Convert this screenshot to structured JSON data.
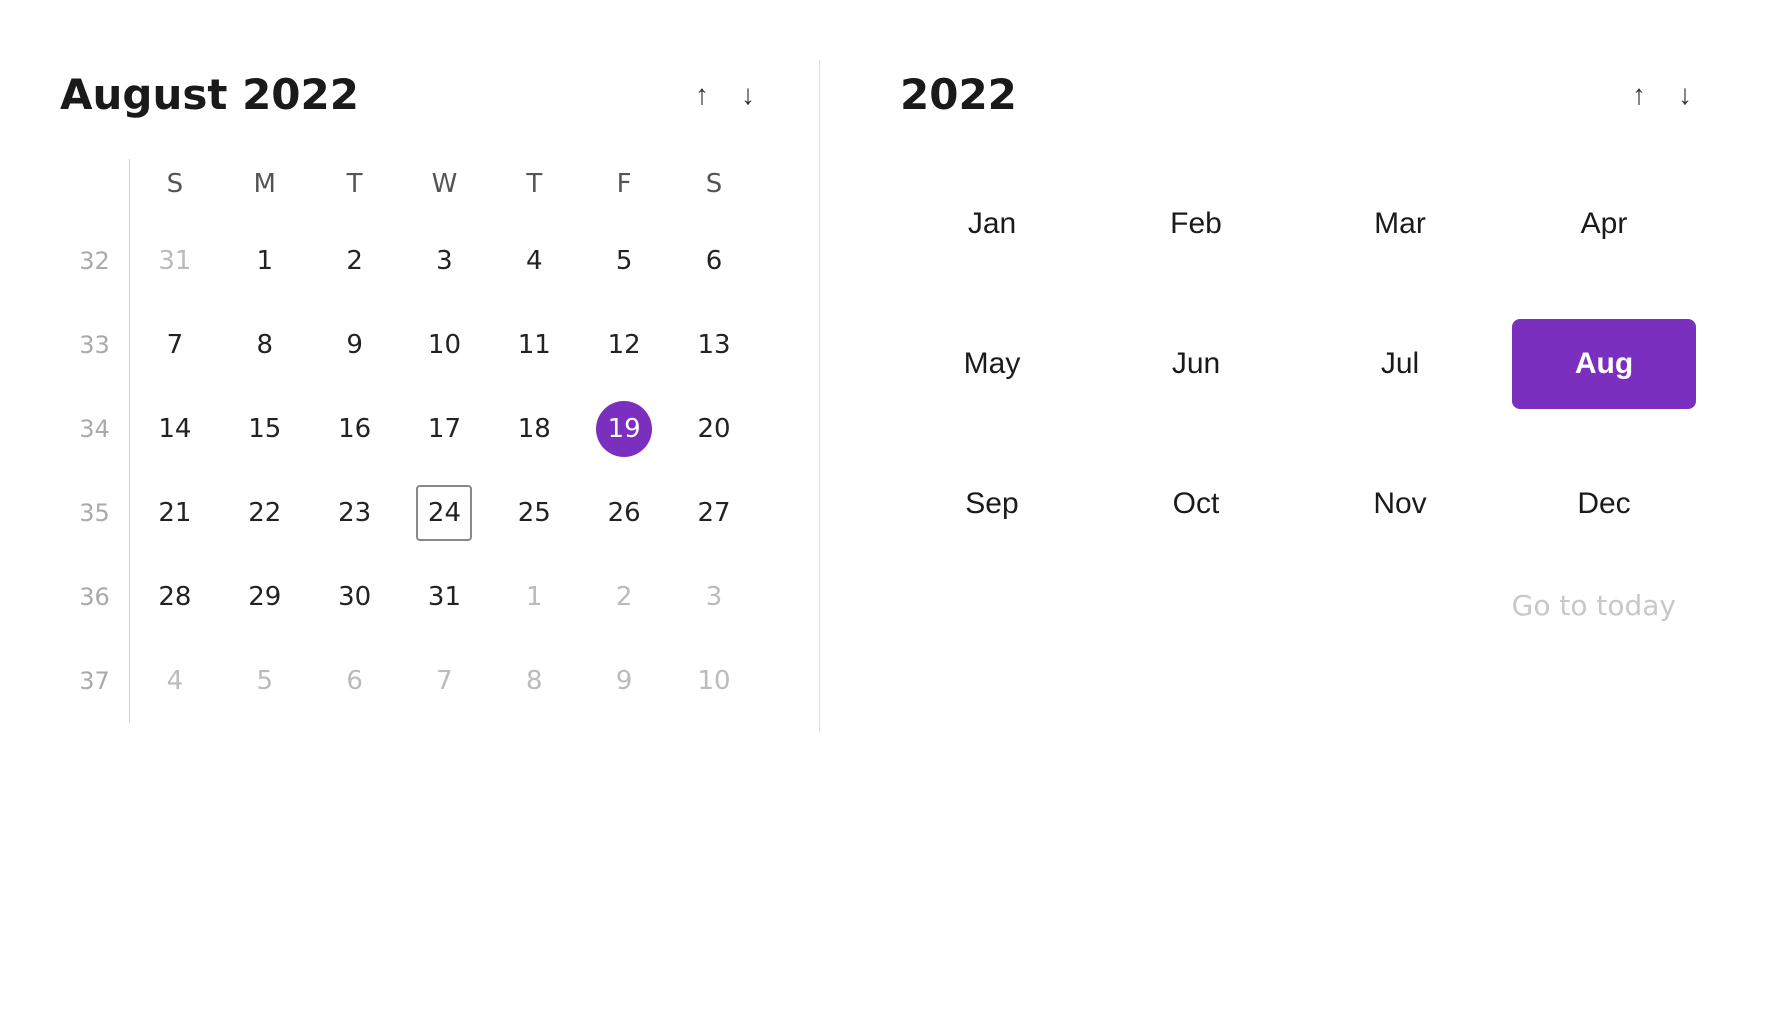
{
  "left": {
    "title": "August 2022",
    "nav_up_label": "↑",
    "nav_down_label": "↓",
    "day_headers": [
      "S",
      "M",
      "T",
      "W",
      "T",
      "F",
      "S"
    ],
    "weeks": [
      {
        "week_num": "32",
        "days": [
          {
            "num": "31",
            "other": true
          },
          {
            "num": "1"
          },
          {
            "num": "2"
          },
          {
            "num": "3"
          },
          {
            "num": "4"
          },
          {
            "num": "5"
          },
          {
            "num": "6"
          }
        ]
      },
      {
        "week_num": "33",
        "days": [
          {
            "num": "7"
          },
          {
            "num": "8"
          },
          {
            "num": "9"
          },
          {
            "num": "10"
          },
          {
            "num": "11"
          },
          {
            "num": "12"
          },
          {
            "num": "13"
          }
        ]
      },
      {
        "week_num": "34",
        "days": [
          {
            "num": "14"
          },
          {
            "num": "15"
          },
          {
            "num": "16"
          },
          {
            "num": "17"
          },
          {
            "num": "18"
          },
          {
            "num": "19",
            "selected": true
          },
          {
            "num": "20"
          }
        ]
      },
      {
        "week_num": "35",
        "days": [
          {
            "num": "21"
          },
          {
            "num": "22"
          },
          {
            "num": "23"
          },
          {
            "num": "24",
            "today_outline": true
          },
          {
            "num": "25"
          },
          {
            "num": "26"
          },
          {
            "num": "27"
          }
        ]
      },
      {
        "week_num": "36",
        "days": [
          {
            "num": "28"
          },
          {
            "num": "29"
          },
          {
            "num": "30"
          },
          {
            "num": "31"
          },
          {
            "num": "1",
            "other": true
          },
          {
            "num": "2",
            "other": true
          },
          {
            "num": "3",
            "other": true
          }
        ]
      },
      {
        "week_num": "37",
        "days": [
          {
            "num": "4",
            "other": true
          },
          {
            "num": "5",
            "other": true
          },
          {
            "num": "6",
            "other": true
          },
          {
            "num": "7",
            "other": true
          },
          {
            "num": "8",
            "other": true
          },
          {
            "num": "9",
            "other": true
          },
          {
            "num": "10",
            "other": true
          }
        ]
      }
    ]
  },
  "right": {
    "year_title": "2022",
    "nav_up_label": "↑",
    "nav_down_label": "↓",
    "months": [
      {
        "label": "Jan",
        "active": false
      },
      {
        "label": "Feb",
        "active": false
      },
      {
        "label": "Mar",
        "active": false
      },
      {
        "label": "Apr",
        "active": false
      },
      {
        "label": "May",
        "active": false
      },
      {
        "label": "Jun",
        "active": false
      },
      {
        "label": "Jul",
        "active": false
      },
      {
        "label": "Aug",
        "active": true
      },
      {
        "label": "Sep",
        "active": false
      },
      {
        "label": "Oct",
        "active": false
      },
      {
        "label": "Nov",
        "active": false
      },
      {
        "label": "Dec",
        "active": false
      }
    ],
    "go_to_today_label": "Go to today"
  }
}
